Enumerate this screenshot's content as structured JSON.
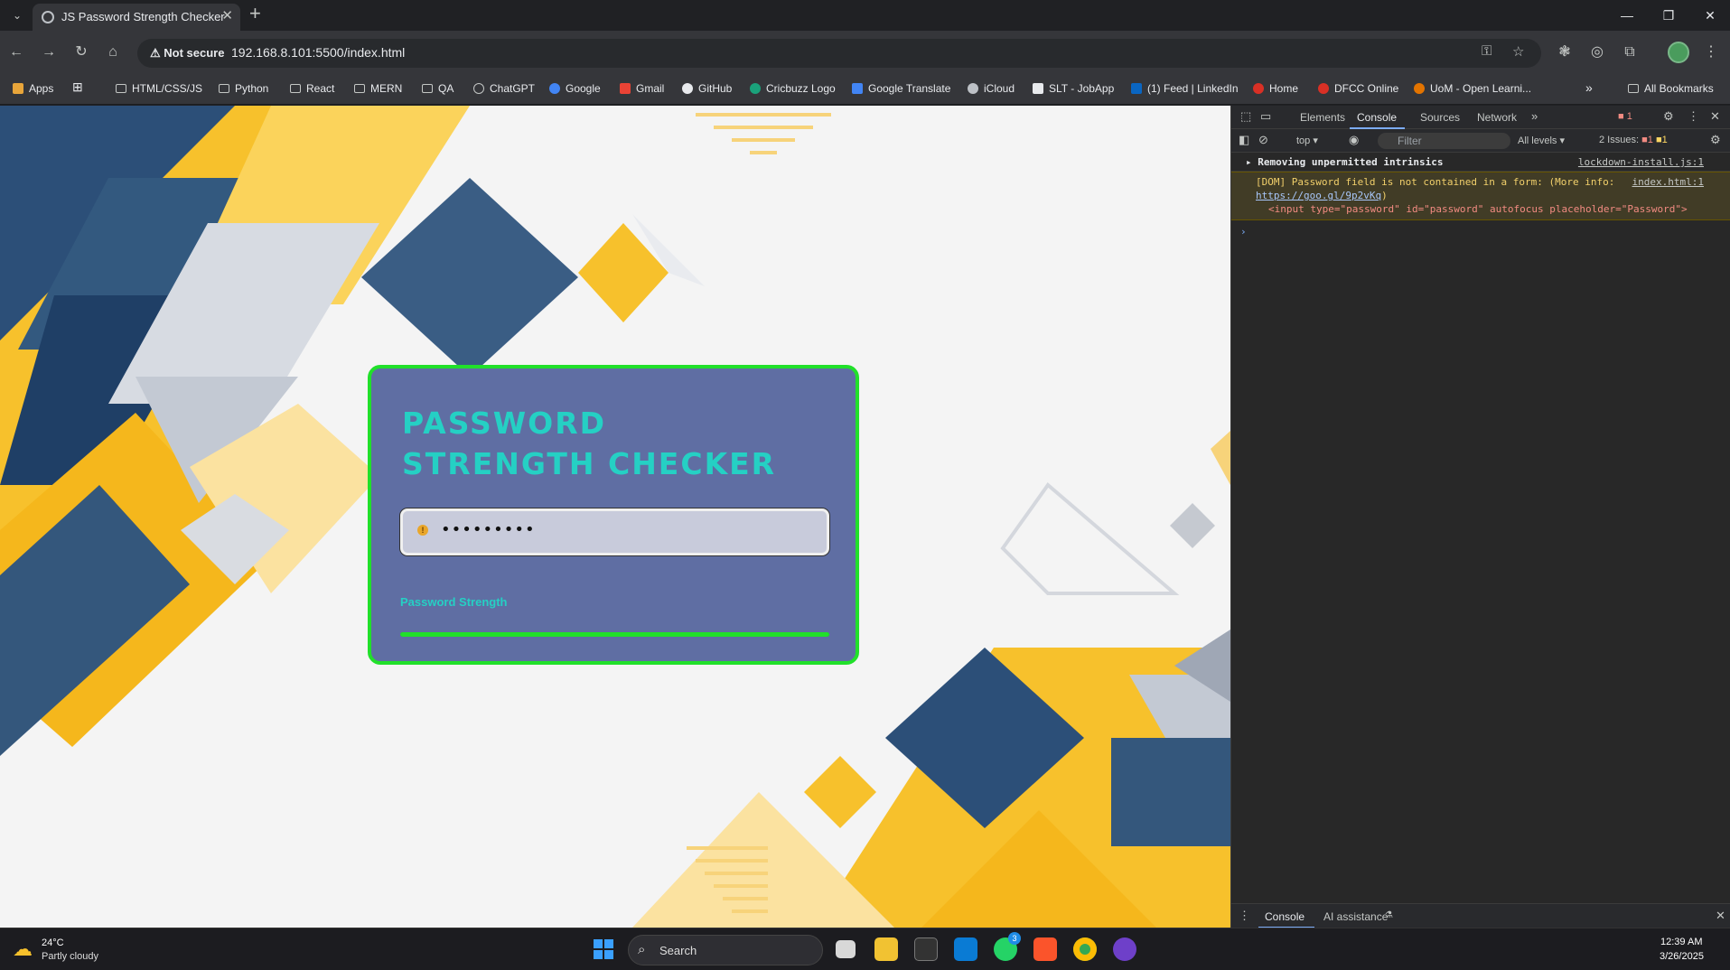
{
  "browser": {
    "tab_title": "JS Password Strength Checker",
    "security_label": "Not secure",
    "url": "192.168.8.101:5500/index.html",
    "new_tab": "+",
    "close": "✕"
  },
  "bookmarks": {
    "items": [
      "Apps",
      "HTML/CSS/JS",
      "Python",
      "React",
      "MERN",
      "QA",
      "ChatGPT",
      "Google",
      "Gmail",
      "GitHub",
      "Cricbuzz Logo",
      "Google Translate",
      "iCloud",
      "SLT - JobApp",
      "(1) Feed | LinkedIn",
      "Home",
      "DFCC Online",
      "UoM - Open Learni..."
    ],
    "all_bookmarks": "All Bookmarks",
    "more": "»"
  },
  "app": {
    "title": "PASSWORD STRENGTH CHECKER",
    "password_dots": "•••••••••",
    "password_placeholder": "Password",
    "strength_label": "Password Strength",
    "strength_fraction": 1.0,
    "card_border_color": "#21e02a",
    "title_color": "#25d0c4"
  },
  "devtools": {
    "tabs": [
      "Elements",
      "Console",
      "Sources",
      "Network"
    ],
    "active_tab": "Console",
    "error_count": "1",
    "context": "top",
    "filter_placeholder": "Filter",
    "levels": "All levels",
    "issues_label": "2 Issues:",
    "issues_err": "1",
    "issues_warn": "1",
    "logs": [
      {
        "text": "Removing unpermitted intrinsics",
        "source": "lockdown-install.js:1"
      },
      {
        "text": "[DOM] Password field is not contained in a form: (More info:",
        "link": "https://goo.gl/9p2vKq",
        "source": "index.html:1",
        "code": "<input type=\"password\" id=\"password\" autofocus placeholder=\"Password\">"
      }
    ],
    "drawer_tabs": [
      "Console",
      "AI assistance"
    ]
  },
  "taskbar": {
    "temp": "24°C",
    "weather": "Partly cloudy",
    "search": "Search",
    "time": "12:39 AM",
    "date": "3/26/2025",
    "whatsapp_badge": "3"
  }
}
